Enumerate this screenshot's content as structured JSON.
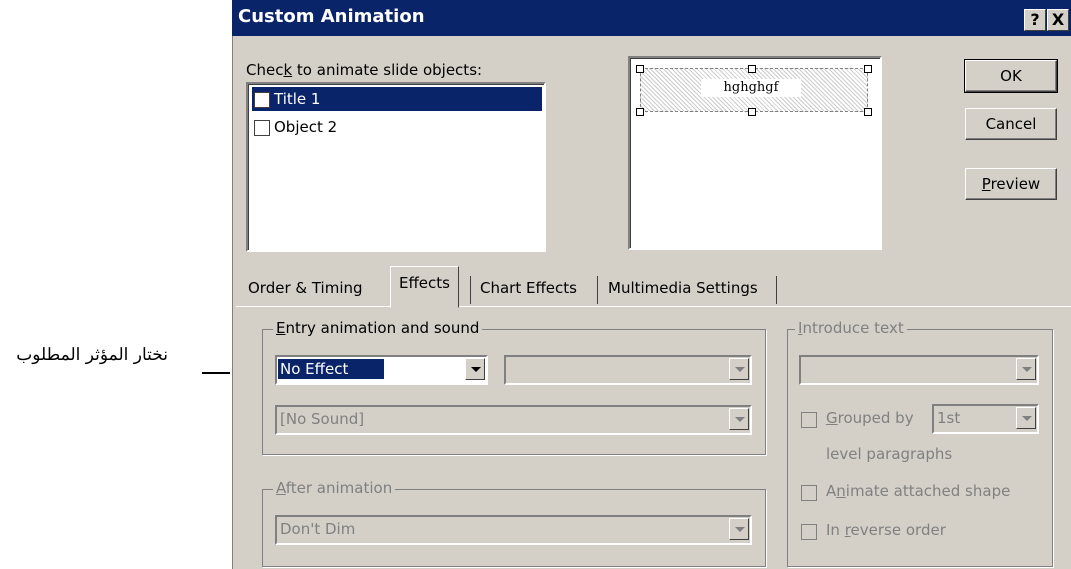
{
  "annotation": {
    "text": "نختار المؤثر المطلوب"
  },
  "dialog": {
    "title": "Custom Animation",
    "help_label": "?",
    "close_label": "X",
    "objects_label": "Check to animate slide objects:",
    "objects": [
      {
        "label": "Title 1",
        "checked": false,
        "selected": true
      },
      {
        "label": "Object 2",
        "checked": false,
        "selected": false
      }
    ],
    "preview": {
      "title_text": "hghghgf"
    },
    "buttons": {
      "ok": "OK",
      "cancel": "Cancel",
      "preview": "Preview"
    },
    "tabs": [
      {
        "label": "Order & Timing",
        "active": false
      },
      {
        "label": "Effects",
        "active": true
      },
      {
        "label": "Chart Effects",
        "active": false
      },
      {
        "label": "Multimedia Settings",
        "active": false
      }
    ],
    "entry": {
      "group_label": "Entry animation and sound",
      "effect_value": "No Effect",
      "direction_value": "",
      "sound_value": "[No Sound]"
    },
    "after": {
      "group_label": "After animation",
      "value": "Don't Dim"
    },
    "introduce": {
      "group_label": "Introduce text",
      "value": "",
      "grouped_by_label": "Grouped by",
      "grouped_by_value": "1st",
      "level_label": "level paragraphs",
      "animate_shape_label": "Animate attached shape",
      "reverse_label": "In reverse order"
    }
  }
}
